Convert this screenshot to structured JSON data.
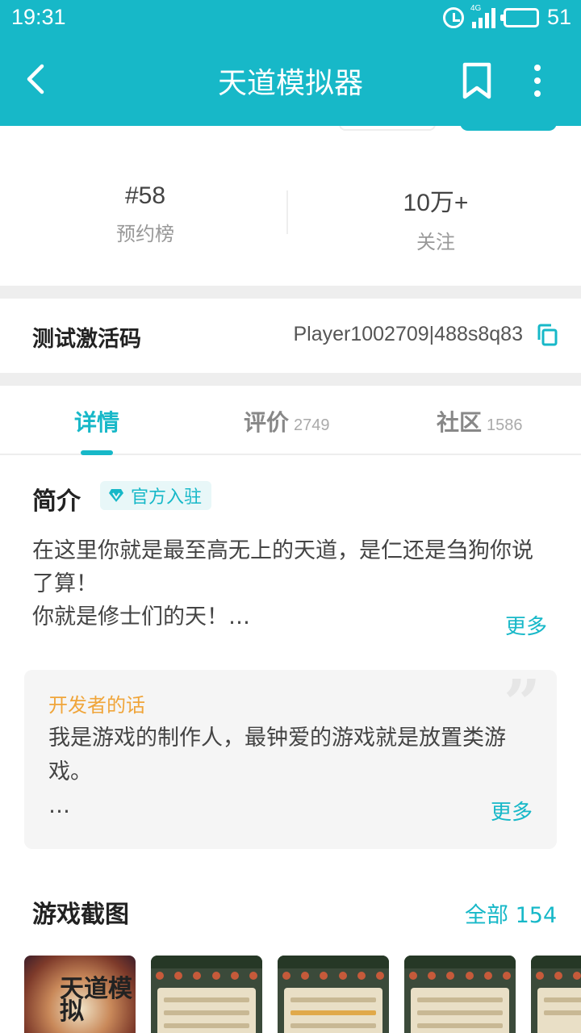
{
  "status_bar": {
    "time": "19:31",
    "network": "4G",
    "battery": "51"
  },
  "nav": {
    "title": "天道模拟器"
  },
  "stats": [
    {
      "value": "#58",
      "label": "预约榜"
    },
    {
      "value": "10万+",
      "label": "关注"
    }
  ],
  "activation": {
    "label": "测试激活码",
    "code": "Player1002709|488s8q83"
  },
  "tabs": [
    {
      "label": "详情",
      "count": ""
    },
    {
      "label": "评价",
      "count": "2749"
    },
    {
      "label": "社区",
      "count": "1586"
    }
  ],
  "intro": {
    "title": "简介",
    "badge": "官方入驻",
    "line1": "在这里你就是最至高无上的天道，是仁还是刍狗你说了算！",
    "line2": "你就是修士们的天！…",
    "more": "更多"
  },
  "developer": {
    "label": "开发者的话",
    "text": "我是游戏的制作人，最钟爱的游戏就是放置类游戏。",
    "ellipsis": "…",
    "more": "更多"
  },
  "screenshots": {
    "title": "游戏截图",
    "all_label": "全部 154",
    "cover_text": "天道模拟"
  },
  "colors": {
    "accent": "#17b8c8",
    "developer_label": "#f0a53a"
  }
}
